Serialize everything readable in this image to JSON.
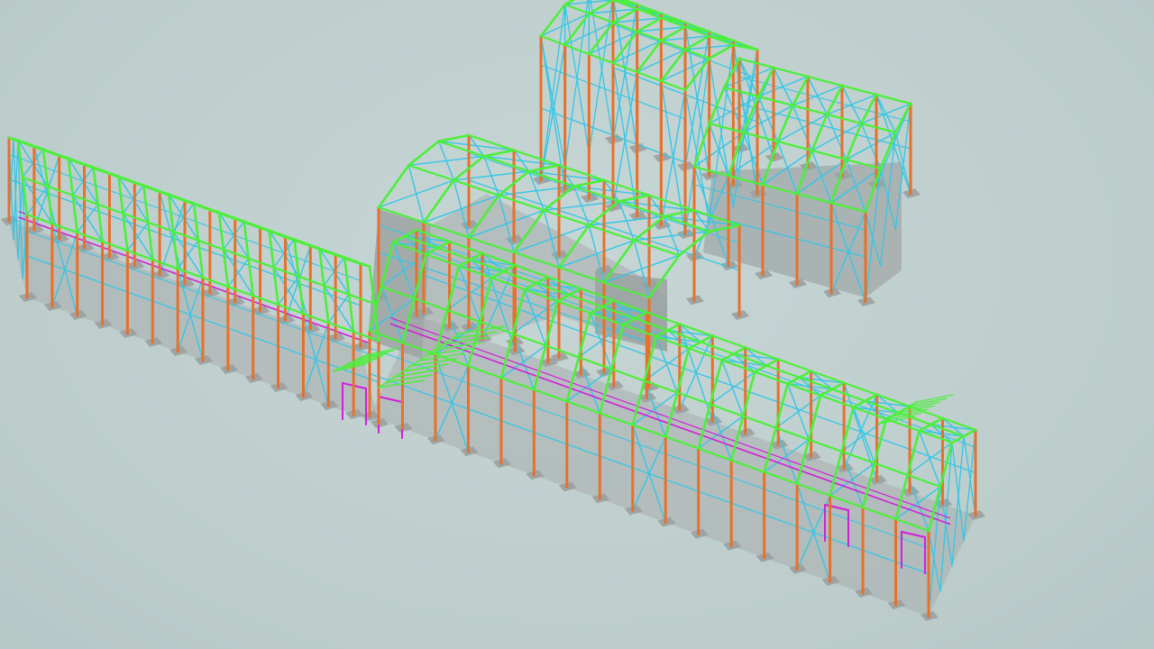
{
  "view": {
    "type": "3d-structural-model",
    "background_color": "#bfd0cf"
  },
  "colors": {
    "column": "#e8702a",
    "rafter": "#4cef3a",
    "bracing": "#35c6e6",
    "secondary": "#d21fd8",
    "slab": "#a9adad",
    "footing": "#9aa09f"
  }
}
